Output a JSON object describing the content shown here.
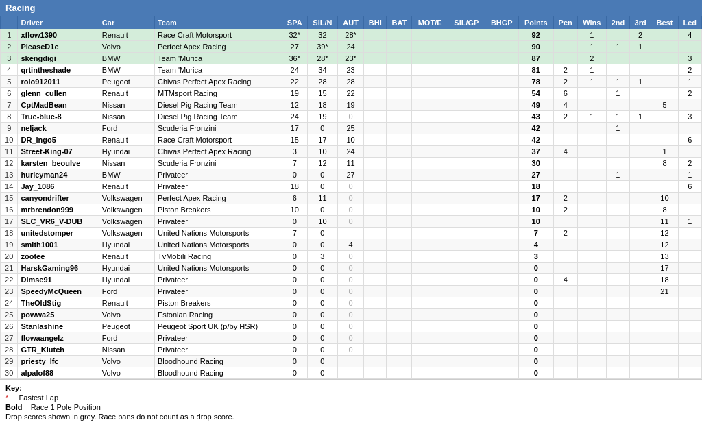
{
  "header": {
    "title": "Racing"
  },
  "columns": [
    "",
    "Driver",
    "Car",
    "Team",
    "SPA",
    "SIL/N",
    "AUT",
    "BHI",
    "BAT",
    "MOT/E",
    "SIL/GP",
    "BHGP",
    "Points",
    "Pen",
    "Wins",
    "2nd",
    "3rd",
    "Best",
    "Led"
  ],
  "rows": [
    {
      "pos": 1,
      "driver": "xflow1390",
      "car": "Renault",
      "team": "Race Craft Motorsport",
      "spa": "32*",
      "sil": "32",
      "aut": "28*",
      "bhi": "",
      "bat": "",
      "mote": "",
      "silgp": "",
      "bhgp": "",
      "points": "92",
      "pen": "",
      "wins": "1",
      "second": "",
      "third": "2",
      "best": "",
      "led": "4",
      "highlight": true
    },
    {
      "pos": 2,
      "driver": "PleaseD1e",
      "car": "Volvo",
      "team": "Perfect Apex Racing",
      "spa": "27",
      "sil": "39*",
      "aut": "24",
      "bhi": "",
      "bat": "",
      "mote": "",
      "silgp": "",
      "bhgp": "",
      "points": "90",
      "pen": "",
      "wins": "1",
      "second": "1",
      "third": "1",
      "best": "",
      "led": "",
      "highlight": true
    },
    {
      "pos": 3,
      "driver": "skengdigi",
      "car": "BMW",
      "team": "Team 'Murica",
      "spa": "36*",
      "sil": "28*",
      "aut": "23*",
      "bhi": "",
      "bat": "",
      "mote": "",
      "silgp": "",
      "bhgp": "",
      "points": "87",
      "pen": "",
      "wins": "2",
      "second": "",
      "third": "",
      "best": "",
      "led": "3",
      "highlight": true
    },
    {
      "pos": 4,
      "driver": "qrtintheshade",
      "car": "BMW",
      "team": "Team 'Murica",
      "spa": "24",
      "sil": "34",
      "aut": "23",
      "bhi": "",
      "bat": "",
      "mote": "",
      "silgp": "",
      "bhgp": "",
      "points": "81",
      "pen": "2",
      "wins": "1",
      "second": "",
      "third": "",
      "best": "",
      "led": "2"
    },
    {
      "pos": 5,
      "driver": "rolo912011",
      "car": "Peugeot",
      "team": "Chivas Perfect Apex Racing",
      "spa": "22",
      "sil": "28",
      "aut": "28",
      "bhi": "",
      "bat": "",
      "mote": "",
      "silgp": "",
      "bhgp": "",
      "points": "78",
      "pen": "2",
      "wins": "1",
      "second": "1",
      "third": "1",
      "best": "",
      "led": "1"
    },
    {
      "pos": 6,
      "driver": "glenn_cullen",
      "car": "Renault",
      "team": "MTMsport Racing",
      "spa": "19",
      "sil": "15",
      "aut": "22",
      "bhi": "",
      "bat": "",
      "mote": "",
      "silgp": "",
      "bhgp": "",
      "points": "54",
      "pen": "6",
      "wins": "",
      "second": "1",
      "third": "",
      "best": "",
      "led": "2"
    },
    {
      "pos": 7,
      "driver": "CptMadBean",
      "car": "Nissan",
      "team": "Diesel Pig Racing Team",
      "spa": "12",
      "sil": "18",
      "aut": "19",
      "bhi": "",
      "bat": "",
      "mote": "",
      "silgp": "",
      "bhgp": "",
      "points": "49",
      "pen": "4",
      "wins": "",
      "second": "",
      "third": "",
      "best": "5",
      "led": ""
    },
    {
      "pos": 8,
      "driver": "True-blue-8",
      "car": "Nissan",
      "team": "Diesel Pig Racing Team",
      "spa": "24",
      "sil": "19",
      "aut": "0",
      "bhi": "",
      "bat": "",
      "mote": "",
      "silgp": "",
      "bhgp": "",
      "points": "43",
      "pen": "2",
      "wins": "1",
      "second": "1",
      "third": "1",
      "best": "",
      "led": "3"
    },
    {
      "pos": 9,
      "driver": "neljack",
      "car": "Ford",
      "team": "Scuderia Fronzini",
      "spa": "17",
      "sil": "0",
      "aut": "25",
      "bhi": "",
      "bat": "",
      "mote": "",
      "silgp": "",
      "bhgp": "",
      "points": "42",
      "pen": "",
      "wins": "",
      "second": "1",
      "third": "",
      "best": "",
      "led": ""
    },
    {
      "pos": 10,
      "driver": "DR_ingo5",
      "car": "Renault",
      "team": "Race Craft Motorsport",
      "spa": "15",
      "sil": "17",
      "aut": "10",
      "bhi": "",
      "bat": "",
      "mote": "",
      "silgp": "",
      "bhgp": "",
      "points": "42",
      "pen": "",
      "wins": "",
      "second": "",
      "third": "",
      "best": "",
      "led": "6"
    },
    {
      "pos": 11,
      "driver": "Street-King-07",
      "car": "Hyundai",
      "team": "Chivas Perfect Apex Racing",
      "spa": "3",
      "sil": "10",
      "aut": "24",
      "bhi": "",
      "bat": "",
      "mote": "",
      "silgp": "",
      "bhgp": "",
      "points": "37",
      "pen": "4",
      "wins": "",
      "second": "",
      "third": "",
      "best": "1",
      "led": ""
    },
    {
      "pos": 12,
      "driver": "karsten_beoulve",
      "car": "Nissan",
      "team": "Scuderia Fronzini",
      "spa": "7",
      "sil": "12",
      "aut": "11",
      "bhi": "",
      "bat": "",
      "mote": "",
      "silgp": "",
      "bhgp": "",
      "points": "30",
      "pen": "",
      "wins": "",
      "second": "",
      "third": "",
      "best": "8",
      "led": "2"
    },
    {
      "pos": 13,
      "driver": "hurleyman24",
      "car": "BMW",
      "team": "Privateer",
      "spa": "0",
      "sil": "0",
      "aut": "27",
      "bhi": "",
      "bat": "",
      "mote": "",
      "silgp": "",
      "bhgp": "",
      "points": "27",
      "pen": "",
      "wins": "",
      "second": "1",
      "third": "",
      "best": "",
      "led": "1"
    },
    {
      "pos": 14,
      "driver": "Jay_1086",
      "car": "Renault",
      "team": "Privateer",
      "spa": "18",
      "sil": "0",
      "aut": "0",
      "bhi": "",
      "bat": "",
      "mote": "",
      "silgp": "",
      "bhgp": "",
      "points": "18",
      "pen": "",
      "wins": "",
      "second": "",
      "third": "",
      "best": "",
      "led": "6"
    },
    {
      "pos": 15,
      "driver": "canyondrifter",
      "car": "Volkswagen",
      "team": "Perfect Apex Racing",
      "spa": "6",
      "sil": "11",
      "aut": "0",
      "bhi": "",
      "bat": "",
      "mote": "",
      "silgp": "",
      "bhgp": "",
      "points": "17",
      "pen": "2",
      "wins": "",
      "second": "",
      "third": "",
      "best": "10",
      "led": ""
    },
    {
      "pos": 16,
      "driver": "mrbrendon999",
      "car": "Volkswagen",
      "team": "Piston Breakers",
      "spa": "10",
      "sil": "0",
      "aut": "0",
      "bhi": "",
      "bat": "",
      "mote": "",
      "silgp": "",
      "bhgp": "",
      "points": "10",
      "pen": "2",
      "wins": "",
      "second": "",
      "third": "",
      "best": "8",
      "led": ""
    },
    {
      "pos": 17,
      "driver": "SLC_VR6_V-DUB",
      "car": "Volkswagen",
      "team": "Privateer",
      "spa": "0",
      "sil": "10",
      "aut": "0",
      "bhi": "",
      "bat": "",
      "mote": "",
      "silgp": "",
      "bhgp": "",
      "points": "10",
      "pen": "",
      "wins": "",
      "second": "",
      "third": "",
      "best": "11",
      "led": "1"
    },
    {
      "pos": 18,
      "driver": "unitedstomper",
      "car": "Volkswagen",
      "team": "United Nations Motorsports",
      "spa": "7",
      "sil": "0",
      "aut": "",
      "bhi": "",
      "bat": "",
      "mote": "",
      "silgp": "",
      "bhgp": "",
      "points": "7",
      "pen": "2",
      "wins": "",
      "second": "",
      "third": "",
      "best": "12",
      "led": ""
    },
    {
      "pos": 19,
      "driver": "smith1001",
      "car": "Hyundai",
      "team": "United Nations Motorsports",
      "spa": "0",
      "sil": "0",
      "aut": "4",
      "bhi": "",
      "bat": "",
      "mote": "",
      "silgp": "",
      "bhgp": "",
      "points": "4",
      "pen": "",
      "wins": "",
      "second": "",
      "third": "",
      "best": "12",
      "led": ""
    },
    {
      "pos": 20,
      "driver": "zootee",
      "car": "Renault",
      "team": "TvMobili Racing",
      "spa": "0",
      "sil": "3",
      "aut": "0",
      "bhi": "",
      "bat": "",
      "mote": "",
      "silgp": "",
      "bhgp": "",
      "points": "3",
      "pen": "",
      "wins": "",
      "second": "",
      "third": "",
      "best": "13",
      "led": ""
    },
    {
      "pos": 21,
      "driver": "HarskGaming96",
      "car": "Hyundai",
      "team": "United Nations Motorsports",
      "spa": "0",
      "sil": "0",
      "aut": "0",
      "bhi": "",
      "bat": "",
      "mote": "",
      "silgp": "",
      "bhgp": "",
      "points": "0",
      "pen": "",
      "wins": "",
      "second": "",
      "third": "",
      "best": "17",
      "led": ""
    },
    {
      "pos": 22,
      "driver": "Dimse91",
      "car": "Hyundai",
      "team": "Privateer",
      "spa": "0",
      "sil": "0",
      "aut": "0",
      "bhi": "",
      "bat": "",
      "mote": "",
      "silgp": "",
      "bhgp": "",
      "points": "0",
      "pen": "4",
      "wins": "",
      "second": "",
      "third": "",
      "best": "18",
      "led": ""
    },
    {
      "pos": 23,
      "driver": "SpeedyMcQueen",
      "car": "Ford",
      "team": "Privateer",
      "spa": "0",
      "sil": "0",
      "aut": "0",
      "bhi": "",
      "bat": "",
      "mote": "",
      "silgp": "",
      "bhgp": "",
      "points": "0",
      "pen": "",
      "wins": "",
      "second": "",
      "third": "",
      "best": "21",
      "led": ""
    },
    {
      "pos": 24,
      "driver": "TheOldStig",
      "car": "Renault",
      "team": "Piston Breakers",
      "spa": "0",
      "sil": "0",
      "aut": "0",
      "bhi": "",
      "bat": "",
      "mote": "",
      "silgp": "",
      "bhgp": "",
      "points": "0",
      "pen": "",
      "wins": "",
      "second": "",
      "third": "",
      "best": "",
      "led": ""
    },
    {
      "pos": 25,
      "driver": "powwa25",
      "car": "Volvo",
      "team": "Estonian Racing",
      "spa": "0",
      "sil": "0",
      "aut": "0",
      "bhi": "",
      "bat": "",
      "mote": "",
      "silgp": "",
      "bhgp": "",
      "points": "0",
      "pen": "",
      "wins": "",
      "second": "",
      "third": "",
      "best": "",
      "led": ""
    },
    {
      "pos": 26,
      "driver": "Stanlashine",
      "car": "Peugeot",
      "team": "Peugeot Sport UK (p/by HSR)",
      "spa": "0",
      "sil": "0",
      "aut": "0",
      "bhi": "",
      "bat": "",
      "mote": "",
      "silgp": "",
      "bhgp": "",
      "points": "0",
      "pen": "",
      "wins": "",
      "second": "",
      "third": "",
      "best": "",
      "led": ""
    },
    {
      "pos": 27,
      "driver": "flowaangelz",
      "car": "Ford",
      "team": "Privateer",
      "spa": "0",
      "sil": "0",
      "aut": "0",
      "bhi": "",
      "bat": "",
      "mote": "",
      "silgp": "",
      "bhgp": "",
      "points": "0",
      "pen": "",
      "wins": "",
      "second": "",
      "third": "",
      "best": "",
      "led": ""
    },
    {
      "pos": 28,
      "driver": "GTR_Klutch",
      "car": "Nissan",
      "team": "Privateer",
      "spa": "0",
      "sil": "0",
      "aut": "0",
      "bhi": "",
      "bat": "",
      "mote": "",
      "silgp": "",
      "bhgp": "",
      "points": "0",
      "pen": "",
      "wins": "",
      "second": "",
      "third": "",
      "best": "",
      "led": ""
    },
    {
      "pos": 29,
      "driver": "priesty_lfc",
      "car": "Volvo",
      "team": "Bloodhound Racing",
      "spa": "0",
      "sil": "0",
      "aut": "",
      "bhi": "",
      "bat": "",
      "mote": "",
      "silgp": "",
      "bhgp": "",
      "points": "0",
      "pen": "",
      "wins": "",
      "second": "",
      "third": "",
      "best": "",
      "led": ""
    },
    {
      "pos": 30,
      "driver": "alpalof88",
      "car": "Volvo",
      "team": "Bloodhound Racing",
      "spa": "0",
      "sil": "0",
      "aut": "",
      "bhi": "",
      "bat": "",
      "mote": "",
      "silgp": "",
      "bhgp": "",
      "points": "0",
      "pen": "",
      "wins": "",
      "second": "",
      "third": "",
      "best": "",
      "led": ""
    }
  ],
  "footer": {
    "key_title": "Key:",
    "star_label": "*",
    "star_desc": "Fastest Lap",
    "bold_label": "Bold",
    "bold_desc": "Race 1 Pole Position",
    "drop_note": "Drop scores shown in grey. Race bans do not count as a drop score."
  }
}
